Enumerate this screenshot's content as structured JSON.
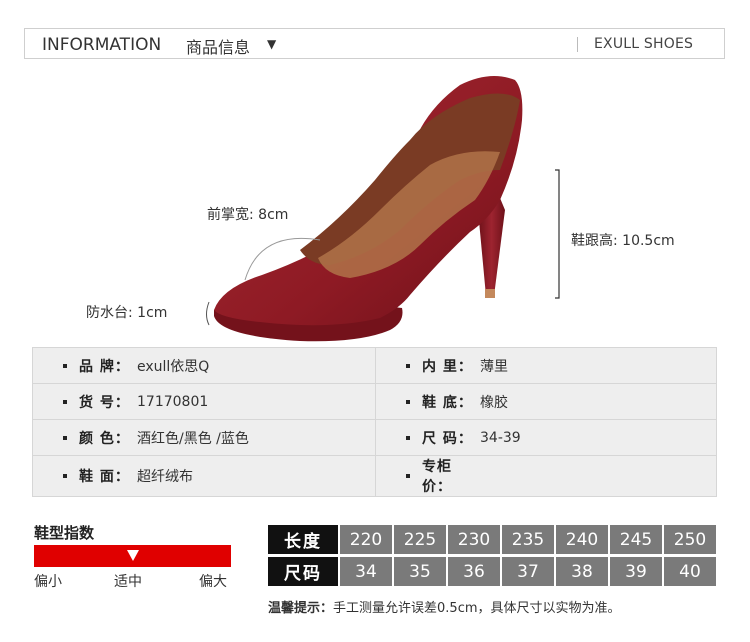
{
  "header": {
    "title_en": "INFORMATION",
    "title_cn": "商品信息",
    "caret": "▼",
    "brand": "EXULL SHOES"
  },
  "measurements": {
    "forefoot_width": "前掌宽: 8cm",
    "heel_height": "鞋跟高: 10.5cm",
    "platform": "防水台: 1cm"
  },
  "specs": [
    {
      "key": "品 牌：",
      "value": "exull依思Q"
    },
    {
      "key": "内 里：",
      "value": "薄里"
    },
    {
      "key": "货 号：",
      "value": "17170801"
    },
    {
      "key": "鞋 底：",
      "value": "橡胶"
    },
    {
      "key": "颜 色：",
      "value": "酒红色/黑色 /蓝色"
    },
    {
      "key": "尺 码：",
      "value": "34-39"
    },
    {
      "key": "鞋 面：",
      "value": "超纤绒布"
    },
    {
      "key": "专柜价：",
      "value": ""
    }
  ],
  "fit_index": {
    "title": "鞋型指数",
    "labels": [
      "偏小",
      "适中",
      "偏大"
    ],
    "level": 0.5
  },
  "size_table": {
    "length_label": "长度",
    "size_label": "尺码",
    "lengths": [
      "220",
      "225",
      "230",
      "235",
      "240",
      "245",
      "250"
    ],
    "sizes": [
      "34",
      "35",
      "36",
      "37",
      "38",
      "39",
      "40"
    ]
  },
  "note": {
    "label": "温馨提示：",
    "text": "手工测量允许误差0.5cm，具体尺寸以实物为准。"
  },
  "colors": {
    "shoe": "#8e1a24",
    "bar": "#e00000",
    "size_header": "#111111",
    "size_cell": "#7a7a7a"
  }
}
